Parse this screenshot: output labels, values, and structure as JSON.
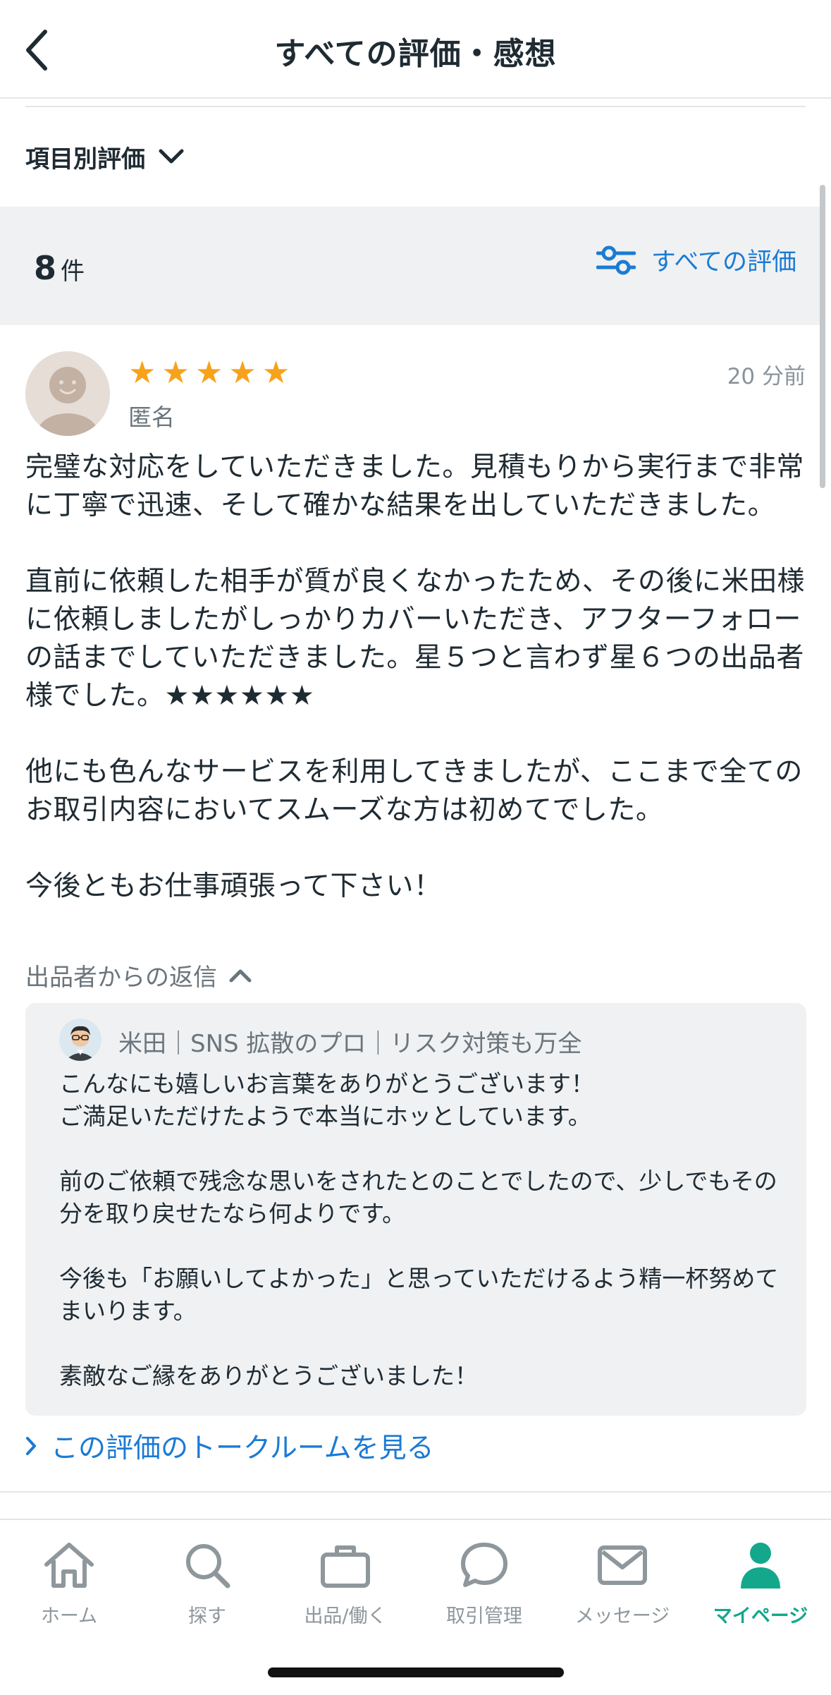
{
  "header": {
    "title": "すべての評価・感想",
    "back_icon": "chevron-left-icon"
  },
  "category_toggle": {
    "label": "項目別評価",
    "icon": "chevron-down-icon"
  },
  "summary": {
    "count": "8",
    "unit": "件",
    "filter_label": "すべての評価",
    "filter_icon": "sliders-icon"
  },
  "review": {
    "rating": 5,
    "reviewer": "匿名",
    "time": "20 分前",
    "paragraphs": [
      "完璧な対応をしていただきました。見積もりから実行まで非常に丁寧で迅速、そして確かな結果を出していただきました。",
      "直前に依頼した相手が質が良くなかったため、その後に米田様に依頼しましたがしっかりカバーいただき、アフターフォローの話までしていただきました。星５つと言わず星６つの出品者様でした。★★★★★★",
      "他にも色んなサービスを利用してきましたが、ここまで全てのお取引内容においてスムーズな方は初めてでした。",
      "今後ともお仕事頑張って下さい！"
    ],
    "reply_toggle_label": "出品者からの返信",
    "reply": {
      "seller_name": "米田｜SNS 拡散のプロ｜リスク対策も万全",
      "paragraphs": [
        "こんなにも嬉しいお言葉をありがとうございます！\nご満足いただけたようで本当にホッとしています。",
        "前のご依頼で残念な思いをされたとのことでしたので、少しでもその分を取り戻せたなら何よりです。",
        "今後も「お願いしてよかった」と思っていただけるよう精一杯努めてまいります。",
        "素敵なご縁をありがとうございました！"
      ]
    },
    "talk_link_label": "この評価のトークルームを見る"
  },
  "tabs": [
    {
      "label": "ホーム",
      "icon": "home-icon",
      "active": false
    },
    {
      "label": "探す",
      "icon": "search-icon",
      "active": false
    },
    {
      "label": "出品/働く",
      "icon": "briefcase-icon",
      "active": false
    },
    {
      "label": "取引管理",
      "icon": "chat-bubble-icon",
      "active": false
    },
    {
      "label": "メッセージ",
      "icon": "envelope-icon",
      "active": false
    },
    {
      "label": "マイページ",
      "icon": "person-icon",
      "active": true
    }
  ],
  "colors": {
    "accent_blue": "#1b7bd4",
    "star": "#f7a21b",
    "active_tab": "#13a88b",
    "muted": "#8e979c"
  }
}
